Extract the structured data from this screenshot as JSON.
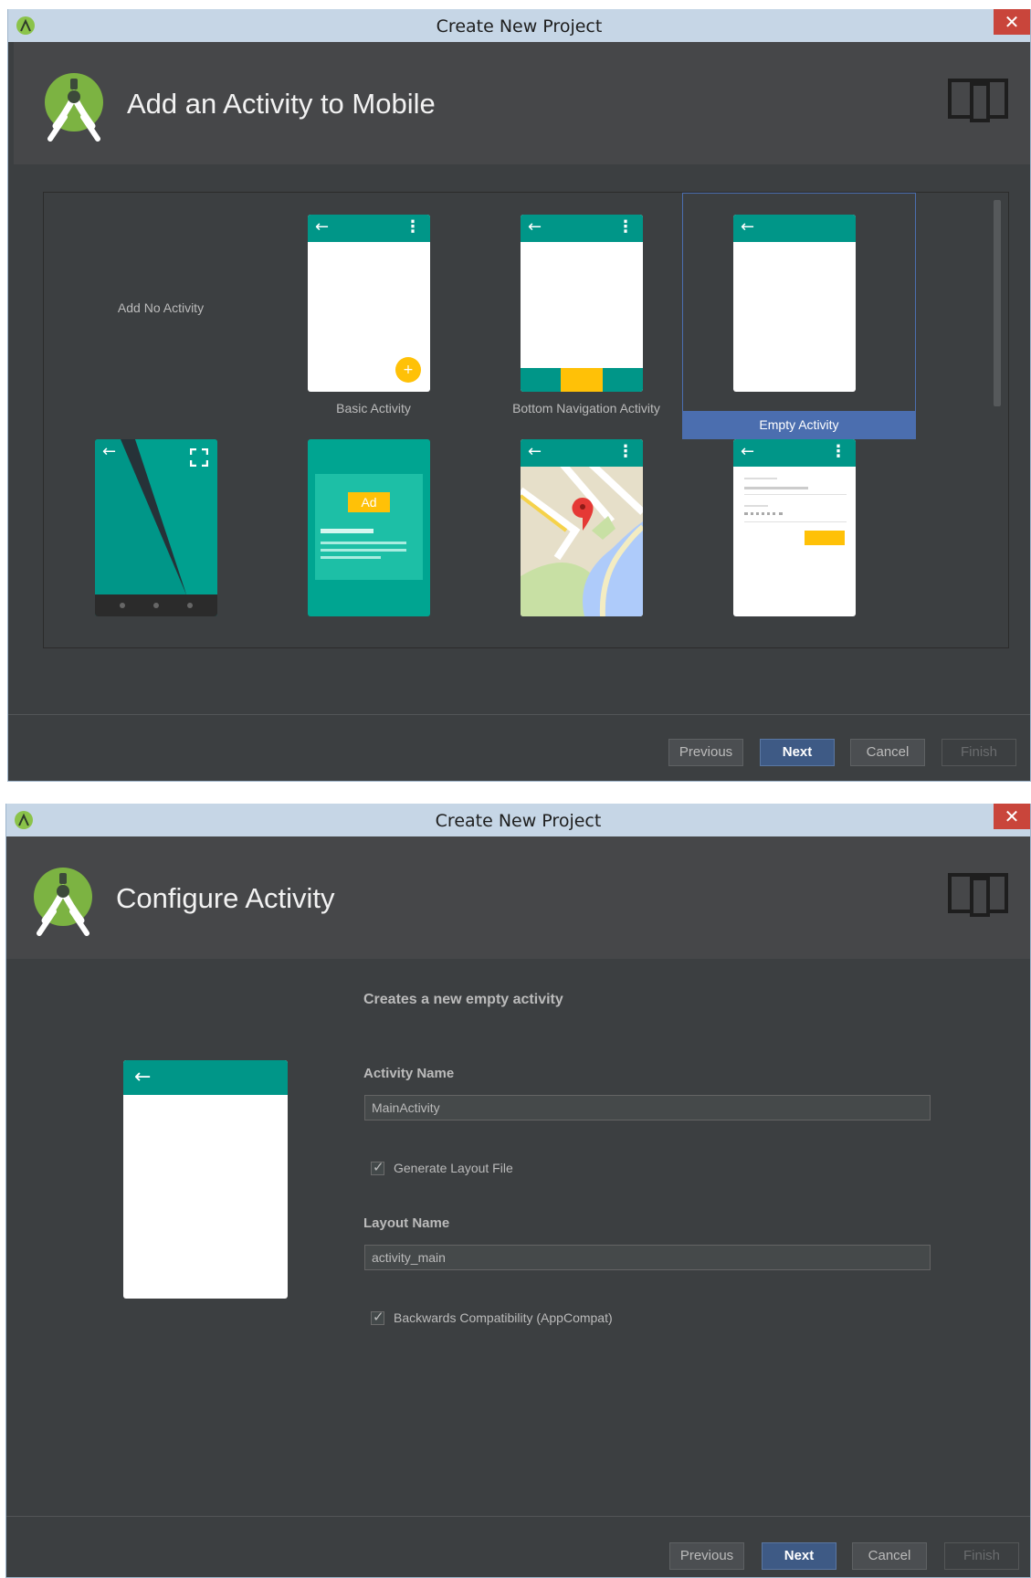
{
  "window1": {
    "title": "Create New Project",
    "close_glyph": "✕",
    "header_title": "Add an Activity to Mobile",
    "gallery": {
      "items": [
        {
          "label": "Add No Activity",
          "template": "none"
        },
        {
          "label": "Basic Activity",
          "template": "basic"
        },
        {
          "label": "Bottom Navigation Activity",
          "template": "bottom-nav"
        },
        {
          "label": "Empty Activity",
          "template": "empty",
          "selected": true
        },
        {
          "label": "",
          "template": "fullscreen"
        },
        {
          "label": "",
          "template": "admob"
        },
        {
          "label": "",
          "template": "maps"
        },
        {
          "label": "",
          "template": "login"
        }
      ],
      "ad_badge": "Ad",
      "fab_glyph": "+"
    },
    "buttons": {
      "previous": "Previous",
      "next": "Next",
      "cancel": "Cancel",
      "finish": "Finish"
    }
  },
  "window2": {
    "title": "Create New Project",
    "close_glyph": "✕",
    "header_title": "Configure Activity",
    "description": "Creates a new empty activity",
    "activity_name_label": "Activity Name",
    "activity_name_value": "MainActivity",
    "generate_layout_label": "Generate Layout File",
    "generate_layout_checked": true,
    "layout_name_label": "Layout Name",
    "layout_name_value": "activity_main",
    "backwards_compat_label": "Backwards Compatibility (AppCompat)",
    "backwards_compat_checked": true,
    "buttons": {
      "previous": "Previous",
      "next": "Next",
      "cancel": "Cancel",
      "finish": "Finish"
    }
  },
  "icons": {
    "back": "←",
    "overflow": "⋮"
  },
  "colors": {
    "accent_teal": "#009688",
    "selection_blue": "#4b6eaf",
    "dialog_bg": "#3c3f41",
    "header_bg": "#464749",
    "titlebar_bg": "#c6d6e6",
    "close_red": "#c9453b",
    "amber": "#ffc107"
  }
}
